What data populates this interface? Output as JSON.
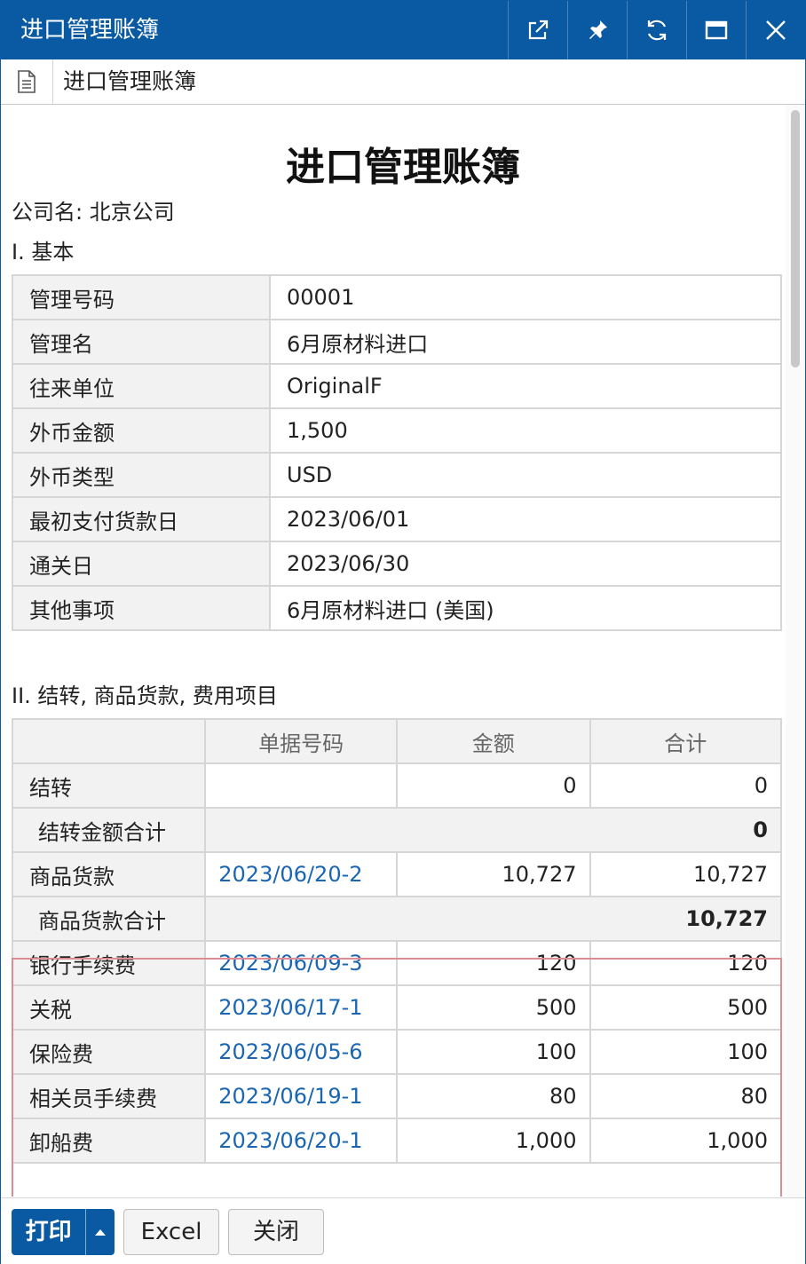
{
  "window": {
    "title": "进口管理账簿",
    "buttons": [
      "popout-icon",
      "pin-icon",
      "refresh-icon",
      "maximize-icon",
      "close-icon"
    ]
  },
  "tab": {
    "title": "进口管理账簿",
    "icon": "document-icon"
  },
  "doc": {
    "title": "进口管理账簿",
    "company": "公司名: 北京公司",
    "section1": "I. 基本",
    "section2": "II. 结转, 商品货款, 费用项目"
  },
  "basic": [
    {
      "label": "管理号码",
      "value": "00001"
    },
    {
      "label": "管理名",
      "value": "6月原材料进口"
    },
    {
      "label": "往来单位",
      "value": "OriginalF"
    },
    {
      "label": "外币金额",
      "value": "1,500"
    },
    {
      "label": "外币类型",
      "value": "USD"
    },
    {
      "label": "最初支付货款日",
      "value": "2023/06/01"
    },
    {
      "label": "通关日",
      "value": "2023/06/30"
    },
    {
      "label": "其他事项",
      "value": "6月原材料进口 (美国)"
    }
  ],
  "expense": {
    "headers": [
      "",
      "单据号码",
      "金额",
      "合计"
    ],
    "carry": {
      "label": "结转",
      "doc": "",
      "amount": "0",
      "total": "0"
    },
    "carry_total": {
      "label": "结转金额合计",
      "value": "0"
    },
    "goods": {
      "label": "商品货款",
      "doc": "2023/06/20-2",
      "amount": "10,727",
      "total": "10,727"
    },
    "goods_total": {
      "label": "商品货款合计",
      "value": "10,727"
    },
    "fees": [
      {
        "label": "银行手续费",
        "doc": "2023/06/09-3",
        "amount": "120",
        "total": "120"
      },
      {
        "label": "关税",
        "doc": "2023/06/17-1",
        "amount": "500",
        "total": "500"
      },
      {
        "label": "保险费",
        "doc": "2023/06/05-6",
        "amount": "100",
        "total": "100"
      },
      {
        "label": "相关员手续费",
        "doc": "2023/06/19-1",
        "amount": "80",
        "total": "80"
      },
      {
        "label": "卸船费",
        "doc": "2023/06/20-1",
        "amount": "1,000",
        "total": "1,000"
      }
    ]
  },
  "footer": {
    "print": "打印",
    "excel": "Excel",
    "close": "关闭"
  },
  "colors": {
    "accent": "#0a5aa3",
    "link": "#1a66b3",
    "highlight": "#e08a93"
  }
}
